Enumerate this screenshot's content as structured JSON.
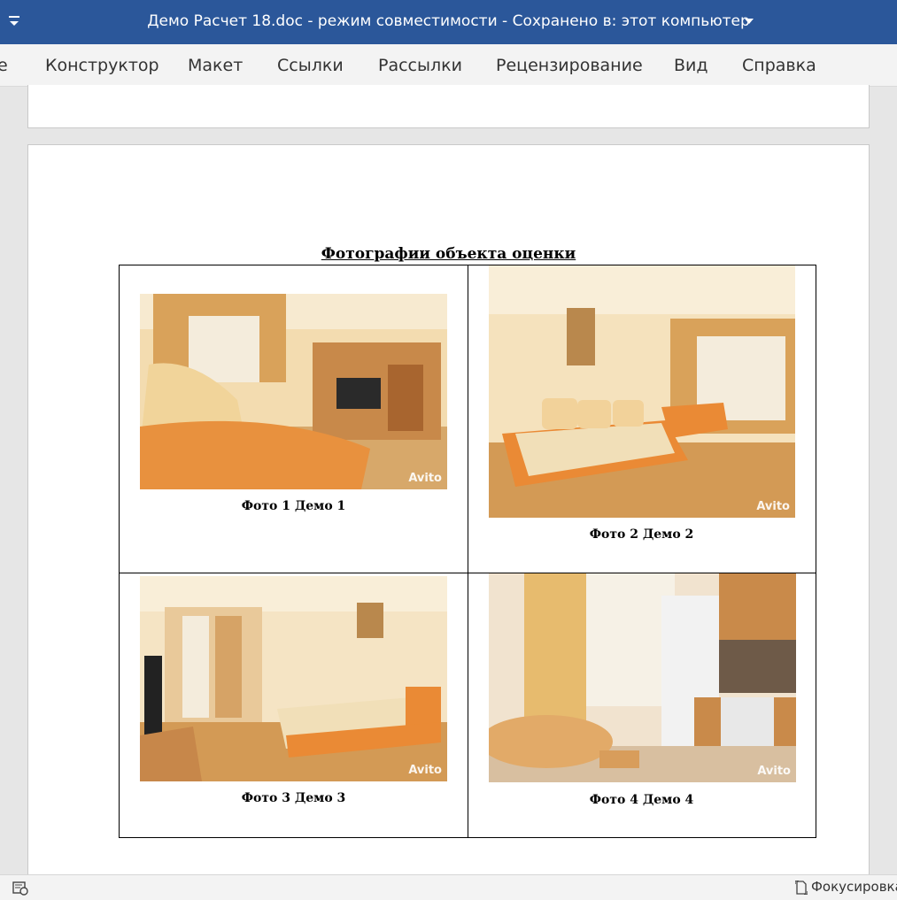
{
  "window": {
    "title": "Демо Расчет 18.doc  -  режим совместимости  -  Сохранено в: этот компьютер"
  },
  "ribbon": {
    "tabs": [
      {
        "label": "е"
      },
      {
        "label": "Конструктор"
      },
      {
        "label": "Макет"
      },
      {
        "label": "Ссылки"
      },
      {
        "label": "Рассылки"
      },
      {
        "label": "Рецензирование"
      },
      {
        "label": "Вид"
      },
      {
        "label": "Справка"
      }
    ]
  },
  "document": {
    "section_title": "Фотографии объекта оценки",
    "photos": [
      {
        "caption": "Фото 1 Демо 1",
        "watermark": "Avito"
      },
      {
        "caption": "Фото 2 Демо 2",
        "watermark": "Avito"
      },
      {
        "caption": "Фото 3 Демо 3",
        "watermark": "Avito"
      },
      {
        "caption": "Фото 4 Демо 4",
        "watermark": "Avito"
      }
    ]
  },
  "statusbar": {
    "focus_label": "Фокусировка"
  },
  "colors": {
    "titlebar": "#2b579a",
    "ribbon": "#f3f3f3",
    "workspace": "#e6e6e6"
  },
  "icons": {
    "quick_access": "quick-access-dropdown-icon",
    "title_caret": "chevron-down-icon",
    "macro": "macro-recording-icon",
    "focus": "focus-mode-icon"
  }
}
